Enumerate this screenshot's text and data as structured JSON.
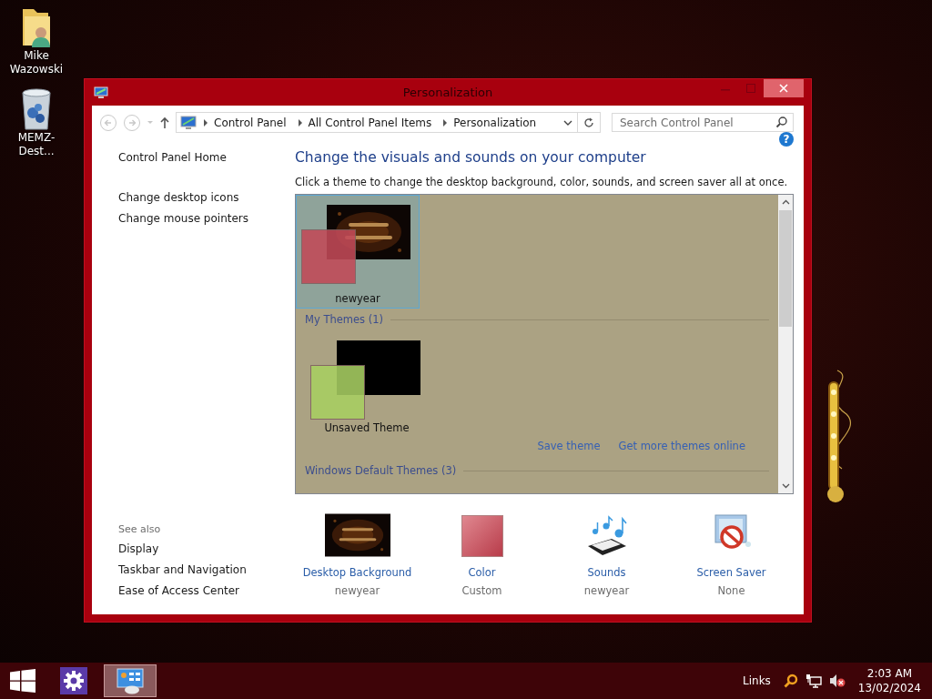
{
  "desktop_icons": [
    {
      "kind": "user-folder",
      "label": "Mike Wazowski"
    },
    {
      "kind": "recycle-bin",
      "label": "MEMZ-Dest..."
    }
  ],
  "window": {
    "title": "Personalization",
    "address": {
      "path": [
        "Control Panel",
        "All Control Panel Items",
        "Personalization"
      ],
      "search": {
        "placeholder": "Search Control Panel"
      }
    },
    "left_pane": {
      "links": [
        "Control Panel Home",
        "Change desktop icons",
        "Change mouse pointers"
      ],
      "see_also": {
        "heading": "See also",
        "links": [
          "Display",
          "Taskbar and Navigation",
          "Ease of Access Center"
        ]
      }
    },
    "help": "?",
    "heading": "Change the visuals and sounds on your computer",
    "description": "Click a theme to change the desktop background, color, sounds, and screen saver all at once.",
    "theme_list": [
      {
        "kind": "theme",
        "name": "newyear",
        "selected": true,
        "color": "#c24a58"
      },
      {
        "kind": "group",
        "title": "My Themes (1)"
      },
      {
        "kind": "theme",
        "name": "Unsaved Theme",
        "selected": false,
        "color": "#a8cf62"
      },
      {
        "kind": "links",
        "links": [
          "Save theme",
          "Get more themes online"
        ]
      },
      {
        "kind": "group",
        "title": "Windows Default Themes (3)"
      }
    ],
    "settings": [
      {
        "kind": "background",
        "label": "Desktop Background",
        "value": "newyear"
      },
      {
        "kind": "color",
        "label": "Color",
        "value": "Custom",
        "color": "#b83c4a"
      },
      {
        "kind": "sounds",
        "label": "Sounds",
        "value": "newyear"
      },
      {
        "kind": "screensaver",
        "label": "Screen Saver",
        "value": "None"
      }
    ]
  },
  "taskbar": {
    "apps": [
      {
        "kind": "settings",
        "selected": false
      },
      {
        "kind": "control-panel",
        "selected": true
      }
    ],
    "toolbar": "Links",
    "clock": {
      "time": "2:03 AM",
      "date": "13/02/2024"
    }
  }
}
